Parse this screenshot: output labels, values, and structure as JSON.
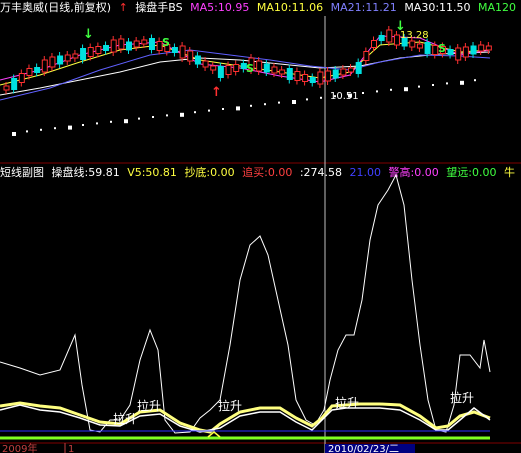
{
  "stock_title": "万丰奥威(日线,前复权)",
  "top_indicator": {
    "name": "操盘手BS",
    "ma": [
      {
        "label": "MA5:10.95",
        "color": "#ff40ff"
      },
      {
        "label": "MA10:11.06",
        "color": "#ffff40"
      },
      {
        "label": "MA21:11.21",
        "color": "#8080ff"
      },
      {
        "label": "MA30:11.50",
        "color": "#ffffff"
      },
      {
        "label": "MA120",
        "color": "#40ff40"
      }
    ]
  },
  "price_labels": {
    "high": "13.28",
    "low": "10.51"
  },
  "signals": {
    "s": "S",
    "up_arrow": "↑",
    "down_arrow": "↓"
  },
  "sub_indicator": {
    "name": "短线副图",
    "items": [
      {
        "label": "操盘线:59.81",
        "color": "#ffffff"
      },
      {
        "label": "V5:50.81",
        "color": "#ffff40"
      },
      {
        "label": "抄底:0.00",
        "color": "#ffff40"
      },
      {
        "label": "追买:0.00",
        "color": "#ff4040"
      },
      {
        "label": ":274.58",
        "color": "#ffffff"
      },
      {
        "label": "21.00",
        "color": "#4040ff"
      },
      {
        "label": "警高:0.00",
        "color": "#ff40ff"
      },
      {
        "label": "望远:0.00",
        "color": "#40ff40"
      },
      {
        "label": "牛",
        "color": "#ffff40"
      }
    ]
  },
  "annotations": {
    "lashing": "拉升"
  },
  "date_axis": {
    "left": "2009年",
    "mid_tick": "1",
    "cursor_date": "2010/02/23/二"
  },
  "colors": {
    "up_candle": "#ff3030",
    "down_candle": "#00e0e0",
    "bg": "#000000",
    "grid": "#800000",
    "cursor": "#c0c0c0"
  }
}
